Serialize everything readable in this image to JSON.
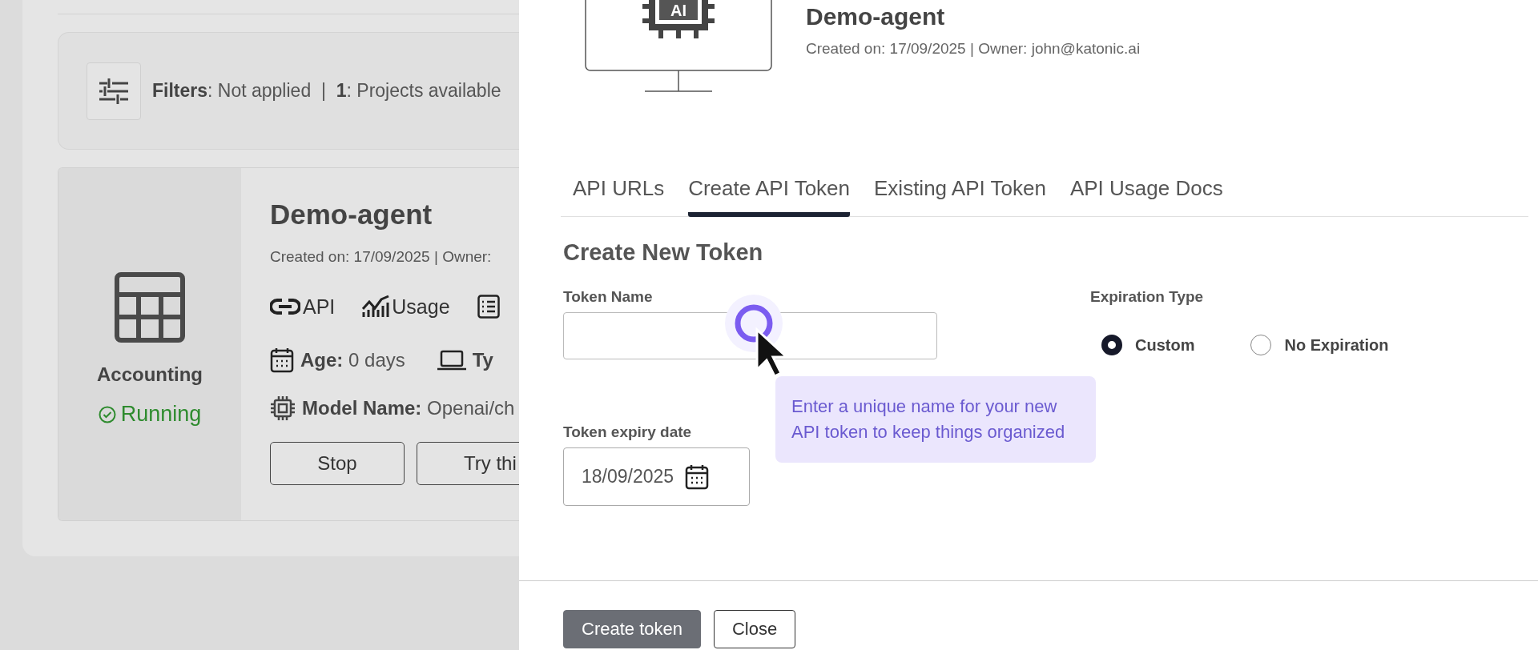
{
  "background_page": {
    "filter_summary": "**Filters**: Not applied  |  **1**: Projects available",
    "project_card": {
      "category": "Accounting",
      "status": "Running",
      "title": "Demo-agent",
      "meta": "Created on: 17/09/2025 | Owner:",
      "links": [
        {
          "label": "API"
        },
        {
          "label": "Usage"
        }
      ],
      "age": "**Age:** 0 days",
      "type": "Ty",
      "model": "**Model Name:** Openai/ch",
      "buttons": [
        "Stop",
        "Try thi"
      ]
    }
  },
  "drawer": {
    "icon_badge": "AI",
    "title": "Demo-agent",
    "meta": "Created on: 17/09/2025 | Owner: john@katonic.ai",
    "tabs": [
      {
        "label": "API URLs",
        "selected": false
      },
      {
        "label": "Create API Token",
        "selected": true
      },
      {
        "label": "Existing API Token",
        "selected": false
      },
      {
        "label": "API Usage Docs",
        "selected": false
      }
    ],
    "form": {
      "heading": "Create New Token",
      "token_name": {
        "label": "Token Name"
      },
      "expiration_type": {
        "label": "Expiration Type",
        "options": [
          {
            "label": "Custom",
            "selected": true
          },
          {
            "label": "No Expiration",
            "selected": false
          }
        ]
      },
      "expiry_date": {
        "label": "Token expiry date",
        "value": "18/09/2025"
      },
      "tooltip": "Enter a unique name for your new API token to keep things organized"
    },
    "buttons": [
      "Create token",
      "Close"
    ]
  }
}
